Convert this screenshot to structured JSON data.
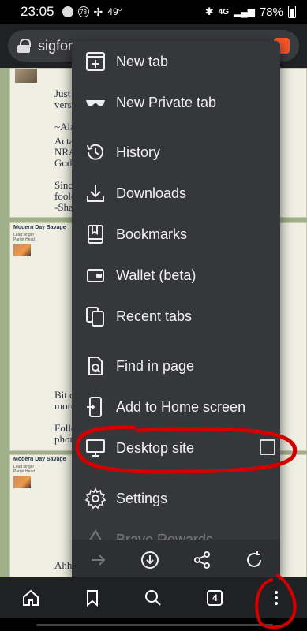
{
  "status": {
    "time": "23:05",
    "notif_count": "78",
    "temp": "49°",
    "network": "4G",
    "battery": "78%"
  },
  "url": {
    "text": "sigfor"
  },
  "page": {
    "lines": [
      "Just",
      "vers",
      "~Ala",
      "Acta",
      "NRA",
      "God,",
      "Sinc",
      "foole",
      "-Sha",
      "Bit o",
      "more",
      "Follo",
      "phon",
      "Ahhh"
    ],
    "poster_name": "Modern Day Savage",
    "poster_sub1": "Lead singer",
    "poster_sub2": "Parrot Head"
  },
  "menu": {
    "items": [
      {
        "label": "New tab",
        "icon": "new-tab-icon"
      },
      {
        "label": "New Private tab",
        "icon": "private-glasses-icon"
      },
      {
        "label": "History",
        "icon": "history-icon"
      },
      {
        "label": "Downloads",
        "icon": "download-icon"
      },
      {
        "label": "Bookmarks",
        "icon": "bookmarks-icon"
      },
      {
        "label": "Wallet (beta)",
        "icon": "wallet-icon"
      },
      {
        "label": "Recent tabs",
        "icon": "recent-tabs-icon"
      },
      {
        "label": "Find in page",
        "icon": "find-in-page-icon"
      },
      {
        "label": "Add to Home screen",
        "icon": "add-to-home-icon"
      },
      {
        "label": "Desktop site",
        "icon": "desktop-icon",
        "checked": false
      },
      {
        "label": "Settings",
        "icon": "settings-icon"
      },
      {
        "label": "Brave Rewards",
        "icon": "rewards-icon"
      }
    ]
  },
  "toolbar": {
    "tab_count": "4"
  },
  "colors": {
    "menu_bg": "#36373b",
    "annotation": "#d40000",
    "forum_bg": "#9fb08a"
  }
}
